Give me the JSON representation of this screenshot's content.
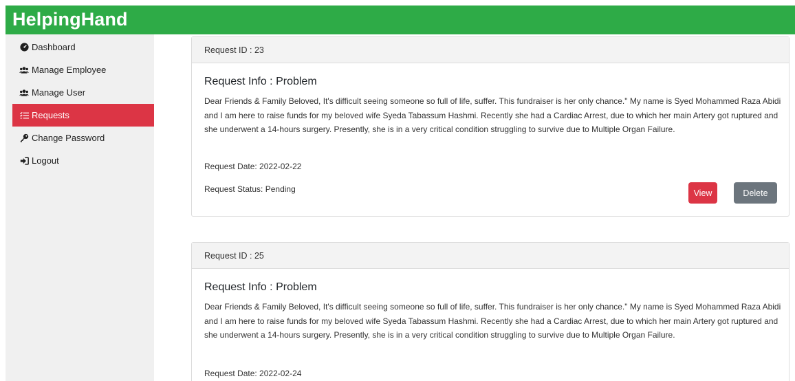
{
  "app": {
    "brand": "HelpingHand"
  },
  "sidebar": {
    "items": [
      {
        "label": "Dashboard"
      },
      {
        "label": "Manage Employee"
      },
      {
        "label": "Manage User"
      },
      {
        "label": "Requests",
        "active": true
      },
      {
        "label": "Change Password"
      },
      {
        "label": "Logout"
      }
    ]
  },
  "requests": [
    {
      "id_text": "Request ID : 23",
      "title": "Request Info : Problem",
      "description": "Dear Friends & Family Beloved, It's difficult seeing someone so full of life, suffer. This fundraiser is her only chance.\" My name is Syed Mohammed Raza Abidi and I am here to raise funds for my beloved wife Syeda Tabassum Hashmi. Recently she had a Cardiac Arrest, due to which her main Artery got ruptured and she underwent a 14-hours surgery. Presently, she is in a very critical condition struggling to survive due to Multiple Organ Failure.",
      "date": "Request Date: 2022-02-22",
      "status": "Request Status: Pending",
      "view_label": "View",
      "delete_label": "Delete"
    },
    {
      "id_text": "Request ID : 25",
      "title": "Request Info : Problem",
      "description": "Dear Friends & Family Beloved, It's difficult seeing someone so full of life, suffer. This fundraiser is her only chance.\" My name is Syed Mohammed Raza Abidi and I am here to raise funds for my beloved wife Syeda Tabassum Hashmi. Recently she had a Cardiac Arrest, due to which her main Artery got ruptured and she underwent a 14-hours surgery. Presently, she is in a very critical condition struggling to survive due to Multiple Organ Failure.",
      "date": "Request Date: 2022-02-24"
    }
  ],
  "colors": {
    "brand_green": "#2eab47",
    "active_red": "#dc3545",
    "delete_gray": "#6c757d"
  }
}
